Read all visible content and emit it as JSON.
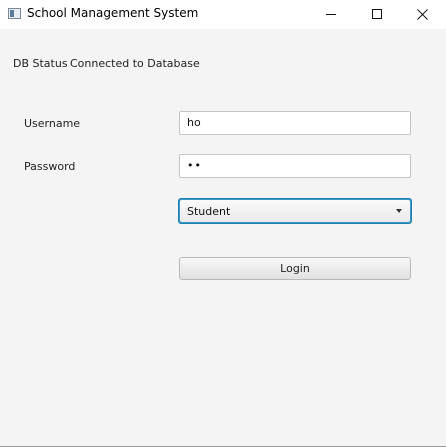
{
  "window": {
    "title": "School Management System"
  },
  "status": {
    "label": "DB Status",
    "value": "Connected to Database"
  },
  "form": {
    "username_label": "Username",
    "username_value": "ho",
    "password_label": "Password",
    "password_value": "••",
    "role_selected": "Student",
    "login_label": "Login"
  },
  "colors": {
    "window_bg": "#f4f4f4",
    "titlebar_bg": "#ffffff",
    "combo_focus": "#3a98c8"
  },
  "icons": {
    "app": "app-window-icon",
    "minimize": "minimize-icon",
    "maximize": "maximize-icon",
    "close": "close-icon",
    "dropdown": "chevron-down-icon"
  }
}
